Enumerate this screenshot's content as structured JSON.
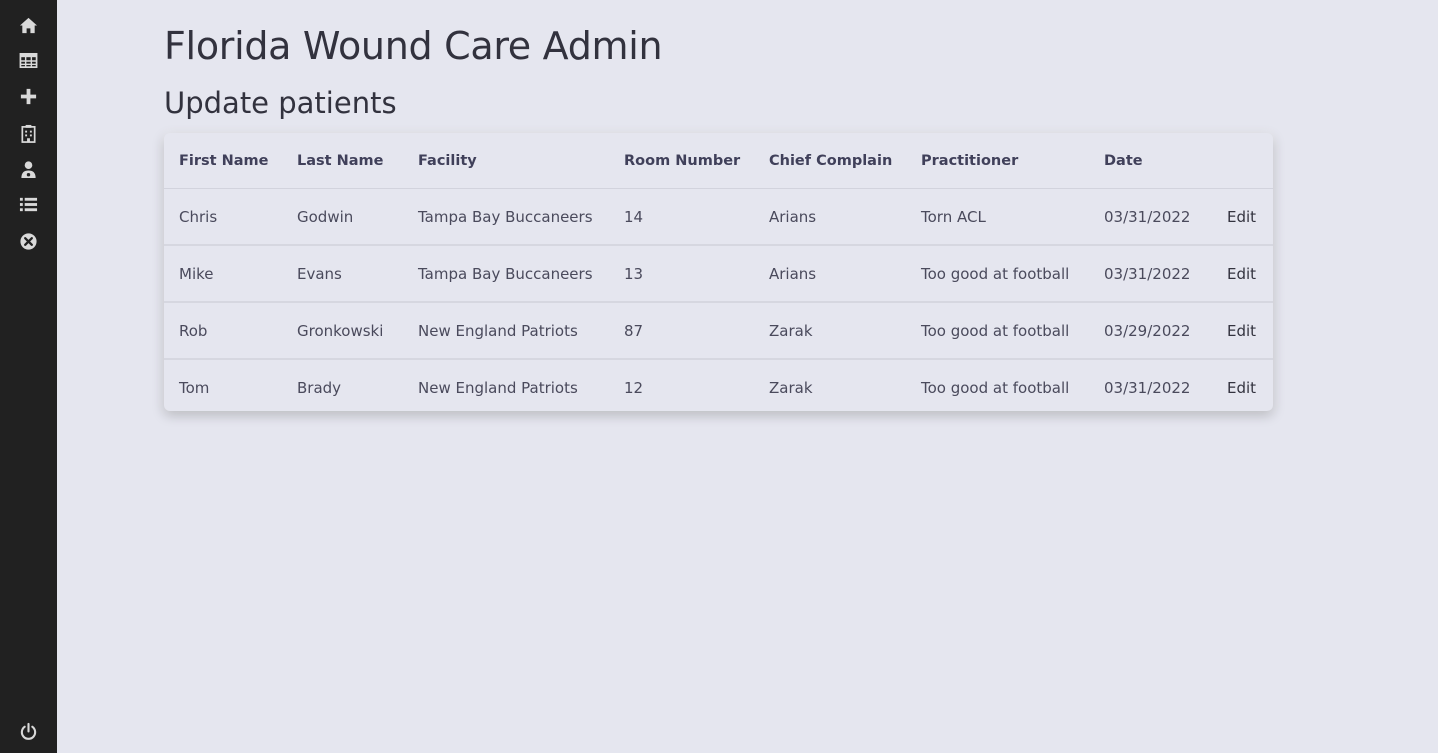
{
  "sidebar": {
    "items": [
      {
        "icon": "home-icon"
      },
      {
        "icon": "table-icon"
      },
      {
        "icon": "plus-icon"
      },
      {
        "icon": "building-icon"
      },
      {
        "icon": "user-doctor-icon"
      },
      {
        "icon": "list-icon"
      },
      {
        "icon": "close-circle-icon"
      }
    ],
    "footer_icon": "power-icon",
    "icon_color": "#d9d9d9",
    "background": "#212121"
  },
  "header": {
    "title": "Florida Wound Care Admin",
    "subtitle": "Update patients"
  },
  "table": {
    "columns": [
      "First Name",
      "Last Name",
      "Facility",
      "Room Number",
      "Chief Complain",
      "Practitioner",
      "Date",
      ""
    ],
    "rows": [
      {
        "first": "Chris",
        "last": "Godwin",
        "facility": "Tampa Bay Buccaneers",
        "room": "14",
        "complain": "Arians",
        "practitioner": "Torn ACL",
        "date": "03/31/2022",
        "action": "Edit"
      },
      {
        "first": "Mike",
        "last": "Evans",
        "facility": "Tampa Bay Buccaneers",
        "room": "13",
        "complain": "Arians",
        "practitioner": "Too good at football",
        "date": "03/31/2022",
        "action": "Edit"
      },
      {
        "first": "Rob",
        "last": "Gronkowski",
        "facility": "New England Patriots",
        "room": "87",
        "complain": "Zarak",
        "practitioner": "Too good at football",
        "date": "03/29/2022",
        "action": "Edit"
      },
      {
        "first": "Tom",
        "last": "Brady",
        "facility": "New England Patriots",
        "room": "12",
        "complain": "Zarak",
        "practitioner": "Too good at football",
        "date": "03/31/2022",
        "action": "Edit"
      }
    ]
  }
}
